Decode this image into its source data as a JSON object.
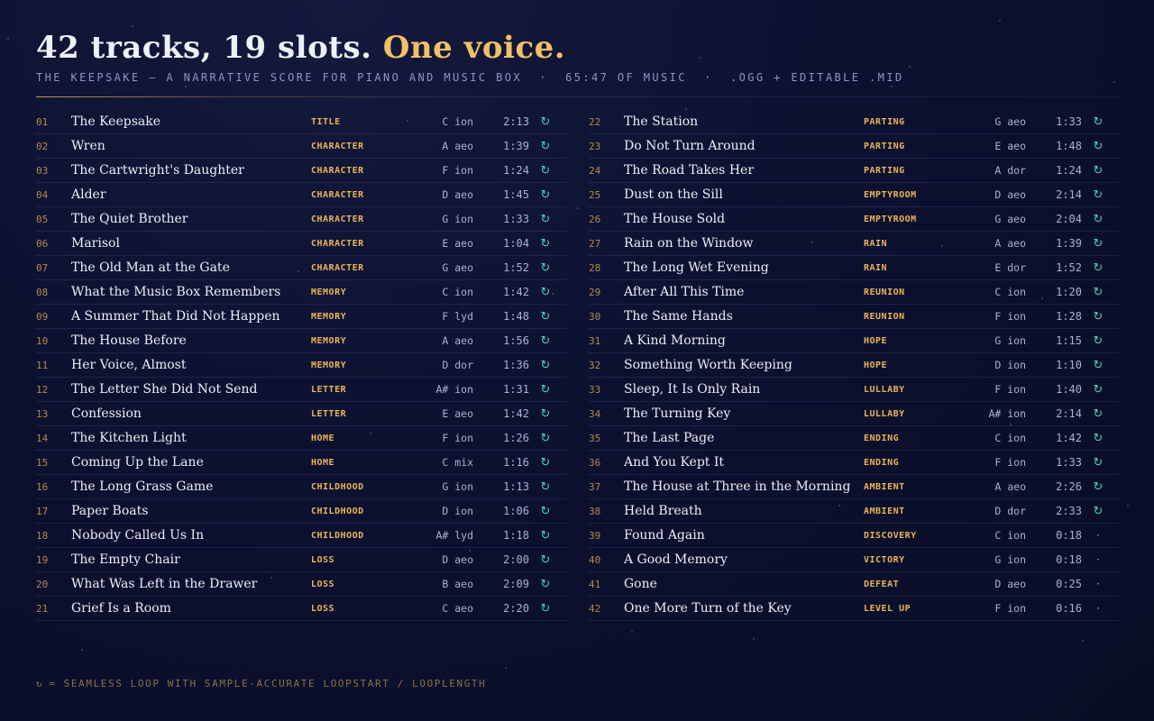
{
  "header": {
    "title_main": "42 tracks, 19 slots.",
    "title_accent": "One voice.",
    "subtitle": "THE KEEPSAKE — A NARRATIVE SCORE FOR PIANO AND MUSIC BOX  ·  65:47 OF MUSIC  ·  .OGG + EDITABLE .MID"
  },
  "loop_symbol": "↻",
  "oneshot_symbol": "·",
  "tracks_left": [
    {
      "num": "01",
      "name": "The Keepsake",
      "tag": "TITLE",
      "key": "C ion",
      "dur": "2:13",
      "loop": true
    },
    {
      "num": "02",
      "name": "Wren",
      "tag": "CHARACTER",
      "key": "A aeo",
      "dur": "1:39",
      "loop": true
    },
    {
      "num": "03",
      "name": "The Cartwright's Daughter",
      "tag": "CHARACTER",
      "key": "F ion",
      "dur": "1:24",
      "loop": true
    },
    {
      "num": "04",
      "name": "Alder",
      "tag": "CHARACTER",
      "key": "D aeo",
      "dur": "1:45",
      "loop": true
    },
    {
      "num": "05",
      "name": "The Quiet Brother",
      "tag": "CHARACTER",
      "key": "G ion",
      "dur": "1:33",
      "loop": true
    },
    {
      "num": "06",
      "name": "Marisol",
      "tag": "CHARACTER",
      "key": "E aeo",
      "dur": "1:04",
      "loop": true
    },
    {
      "num": "07",
      "name": "The Old Man at the Gate",
      "tag": "CHARACTER",
      "key": "G aeo",
      "dur": "1:52",
      "loop": true
    },
    {
      "num": "08",
      "name": "What the Music Box Remembers",
      "tag": "MEMORY",
      "key": "C ion",
      "dur": "1:42",
      "loop": true
    },
    {
      "num": "09",
      "name": "A Summer That Did Not Happen",
      "tag": "MEMORY",
      "key": "F lyd",
      "dur": "1:48",
      "loop": true
    },
    {
      "num": "10",
      "name": "The House Before",
      "tag": "MEMORY",
      "key": "A aeo",
      "dur": "1:56",
      "loop": true
    },
    {
      "num": "11",
      "name": "Her Voice, Almost",
      "tag": "MEMORY",
      "key": "D dor",
      "dur": "1:36",
      "loop": true
    },
    {
      "num": "12",
      "name": "The Letter She Did Not Send",
      "tag": "LETTER",
      "key": "A# ion",
      "dur": "1:31",
      "loop": true
    },
    {
      "num": "13",
      "name": "Confession",
      "tag": "LETTER",
      "key": "E aeo",
      "dur": "1:42",
      "loop": true
    },
    {
      "num": "14",
      "name": "The Kitchen Light",
      "tag": "HOME",
      "key": "F ion",
      "dur": "1:26",
      "loop": true
    },
    {
      "num": "15",
      "name": "Coming Up the Lane",
      "tag": "HOME",
      "key": "C mix",
      "dur": "1:16",
      "loop": true
    },
    {
      "num": "16",
      "name": "The Long Grass Game",
      "tag": "CHILDHOOD",
      "key": "G ion",
      "dur": "1:13",
      "loop": true
    },
    {
      "num": "17",
      "name": "Paper Boats",
      "tag": "CHILDHOOD",
      "key": "D ion",
      "dur": "1:06",
      "loop": true
    },
    {
      "num": "18",
      "name": "Nobody Called Us In",
      "tag": "CHILDHOOD",
      "key": "A# lyd",
      "dur": "1:18",
      "loop": true
    },
    {
      "num": "19",
      "name": "The Empty Chair",
      "tag": "LOSS",
      "key": "D aeo",
      "dur": "2:00",
      "loop": true
    },
    {
      "num": "20",
      "name": "What Was Left in the Drawer",
      "tag": "LOSS",
      "key": "B aeo",
      "dur": "2:09",
      "loop": true
    },
    {
      "num": "21",
      "name": "Grief Is a Room",
      "tag": "LOSS",
      "key": "C aeo",
      "dur": "2:20",
      "loop": true
    }
  ],
  "tracks_right": [
    {
      "num": "22",
      "name": "The Station",
      "tag": "PARTING",
      "key": "G aeo",
      "dur": "1:33",
      "loop": true
    },
    {
      "num": "23",
      "name": "Do Not Turn Around",
      "tag": "PARTING",
      "key": "E aeo",
      "dur": "1:48",
      "loop": true
    },
    {
      "num": "24",
      "name": "The Road Takes Her",
      "tag": "PARTING",
      "key": "A dor",
      "dur": "1:24",
      "loop": true
    },
    {
      "num": "25",
      "name": "Dust on the Sill",
      "tag": "EMPTYROOM",
      "key": "D aeo",
      "dur": "2:14",
      "loop": true
    },
    {
      "num": "26",
      "name": "The House Sold",
      "tag": "EMPTYROOM",
      "key": "G aeo",
      "dur": "2:04",
      "loop": true
    },
    {
      "num": "27",
      "name": "Rain on the Window",
      "tag": "RAIN",
      "key": "A aeo",
      "dur": "1:39",
      "loop": true
    },
    {
      "num": "28",
      "name": "The Long Wet Evening",
      "tag": "RAIN",
      "key": "E dor",
      "dur": "1:52",
      "loop": true
    },
    {
      "num": "29",
      "name": "After All This Time",
      "tag": "REUNION",
      "key": "C ion",
      "dur": "1:20",
      "loop": true
    },
    {
      "num": "30",
      "name": "The Same Hands",
      "tag": "REUNION",
      "key": "F ion",
      "dur": "1:28",
      "loop": true
    },
    {
      "num": "31",
      "name": "A Kind Morning",
      "tag": "HOPE",
      "key": "G ion",
      "dur": "1:15",
      "loop": true
    },
    {
      "num": "32",
      "name": "Something Worth Keeping",
      "tag": "HOPE",
      "key": "D ion",
      "dur": "1:10",
      "loop": true
    },
    {
      "num": "33",
      "name": "Sleep, It Is Only Rain",
      "tag": "LULLABY",
      "key": "F ion",
      "dur": "1:40",
      "loop": true
    },
    {
      "num": "34",
      "name": "The Turning Key",
      "tag": "LULLABY",
      "key": "A# ion",
      "dur": "2:14",
      "loop": true
    },
    {
      "num": "35",
      "name": "The Last Page",
      "tag": "ENDING",
      "key": "C ion",
      "dur": "1:42",
      "loop": true
    },
    {
      "num": "36",
      "name": "And You Kept It",
      "tag": "ENDING",
      "key": "F ion",
      "dur": "1:33",
      "loop": true
    },
    {
      "num": "37",
      "name": "The House at Three in the Morning",
      "tag": "AMBIENT",
      "key": "A aeo",
      "dur": "2:26",
      "loop": true
    },
    {
      "num": "38",
      "name": "Held Breath",
      "tag": "AMBIENT",
      "key": "D dor",
      "dur": "2:33",
      "loop": true
    },
    {
      "num": "39",
      "name": "Found Again",
      "tag": "DISCOVERY",
      "key": "C ion",
      "dur": "0:18",
      "loop": false
    },
    {
      "num": "40",
      "name": "A Good Memory",
      "tag": "VICTORY",
      "key": "G ion",
      "dur": "0:18",
      "loop": false
    },
    {
      "num": "41",
      "name": "Gone",
      "tag": "DEFEAT",
      "key": "D aeo",
      "dur": "0:25",
      "loop": false
    },
    {
      "num": "42",
      "name": "One More Turn of the Key",
      "tag": "LEVEL UP",
      "key": "F ion",
      "dur": "0:16",
      "loop": false
    }
  ],
  "footer": {
    "symbol": "↻",
    "text": "= SEAMLESS LOOP WITH SAMPLE-ACCURATE LOOPSTART / LOOPLENGTH"
  },
  "colors": {
    "accent": "#f0c068",
    "tag": "#e9b458",
    "loop": "#4fd1b3",
    "background": "#0d1130"
  }
}
